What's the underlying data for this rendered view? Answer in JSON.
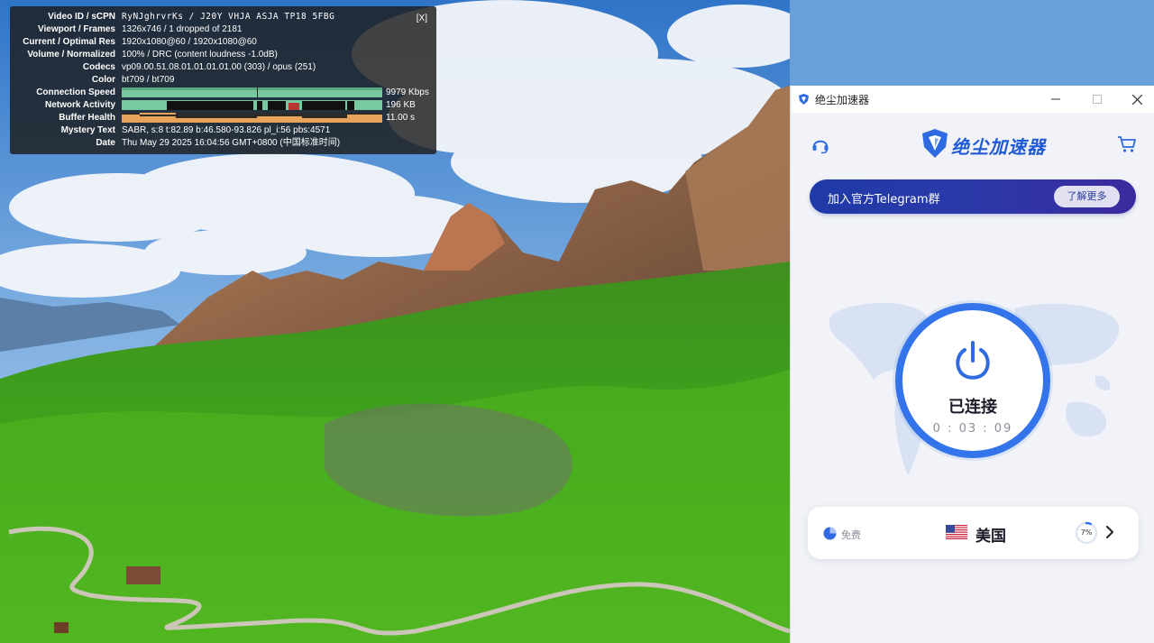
{
  "stats": {
    "close_label": "[X]",
    "rows": [
      {
        "label": "Video ID / sCPN",
        "value": "RyNJghrvrKs  /  J20Y VHJA ASJA TP18 5FBG"
      },
      {
        "label": "Viewport / Frames",
        "value": "1326x746 / 1 dropped of 2181"
      },
      {
        "label": "Current / Optimal Res",
        "value": "1920x1080@60 / 1920x1080@60"
      },
      {
        "label": "Volume / Normalized",
        "value": "100% / DRC (content loudness -1.0dB)"
      },
      {
        "label": "Codecs",
        "value": "vp09.00.51.08.01.01.01.01.00 (303) / opus (251)"
      },
      {
        "label": "Color",
        "value": "bt709 / bt709"
      },
      {
        "label": "Connection Speed",
        "value": "9979 Kbps"
      },
      {
        "label": "Network Activity",
        "value": "196 KB"
      },
      {
        "label": "Buffer Health",
        "value": "11.00 s"
      },
      {
        "label": "Mystery Text",
        "value": "SABR, s:8 t:82.89 b:46.580-93.826 pl_i:56 pbs:4571"
      },
      {
        "label": "Date",
        "value": "Thu May 29 2025 16:04:56 GMT+0800 (中国标准时间)"
      }
    ]
  },
  "app": {
    "window_title": "绝尘加速器",
    "brand_name": "绝尘加速器",
    "banner_text": "加入官方Telegram群",
    "banner_button": "了解更多",
    "status": "已连接",
    "timer": "0 : 03 : 09",
    "server": {
      "tier": "免费",
      "country": "美国",
      "load_label": "7%",
      "load_fraction": 0.07
    },
    "icons": [
      "headset-icon",
      "cart-icon",
      "power-icon",
      "shield-logo-icon",
      "us-flag-icon",
      "chevron-right-icon",
      "pie-icon"
    ],
    "colors": {
      "accent": "#3474ea",
      "banner_start": "#1e3aa8",
      "banner_end": "#3b2a9e",
      "brand": "#1f5ad6"
    }
  }
}
